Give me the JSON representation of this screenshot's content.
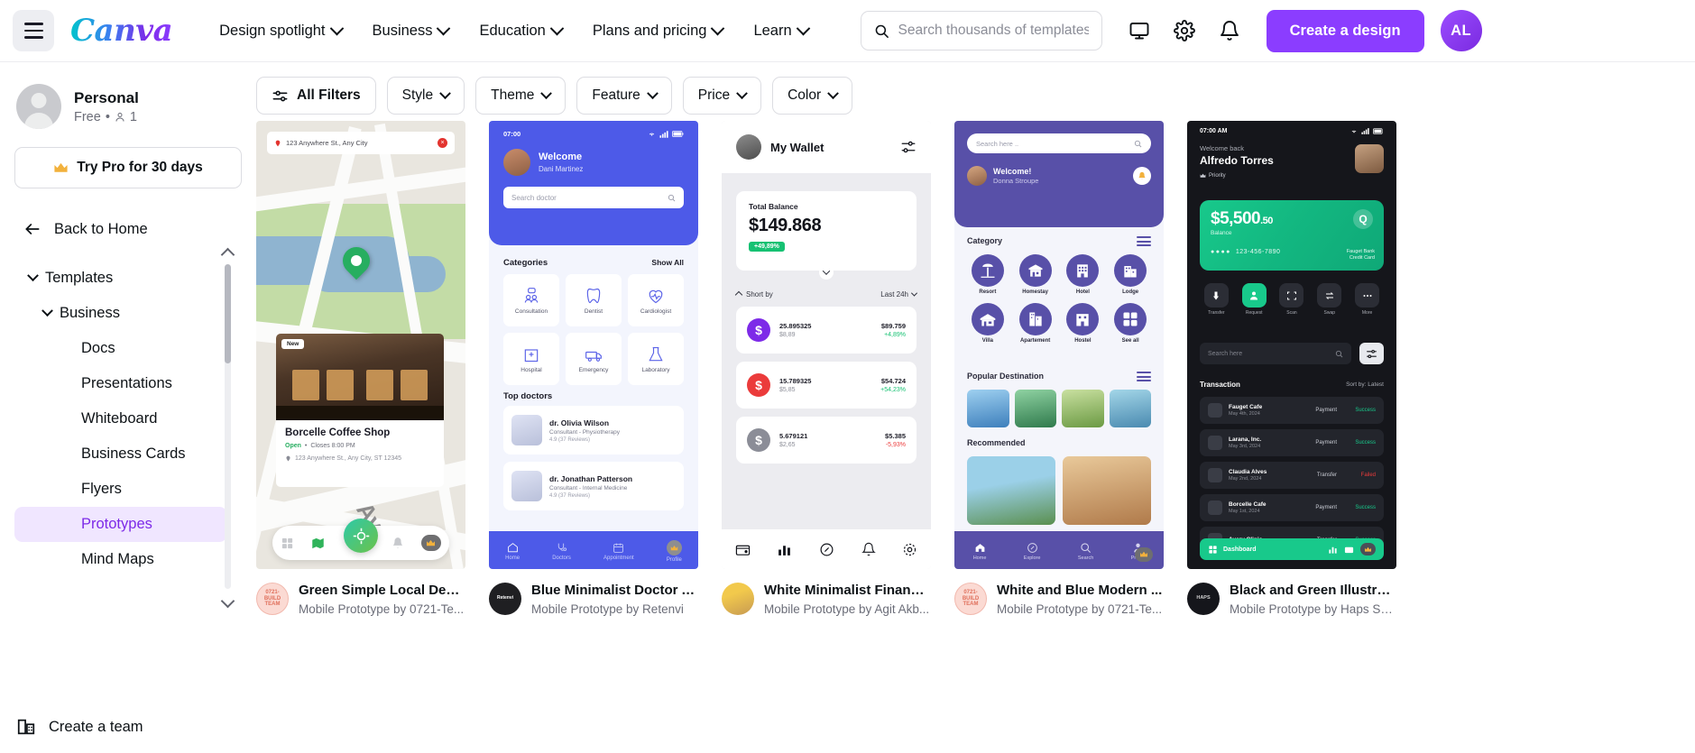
{
  "header": {
    "menu_icon": "hamburger-icon",
    "logo_text": "Canva",
    "nav": [
      {
        "label": "Design spotlight",
        "caret": true
      },
      {
        "label": "Business",
        "caret": true
      },
      {
        "label": "Education",
        "caret": true
      },
      {
        "label": "Plans and pricing",
        "caret": true
      },
      {
        "label": "Learn",
        "caret": true
      }
    ],
    "search": {
      "placeholder": "Search thousands of templates",
      "value": "",
      "icon": "search-icon"
    },
    "icons": [
      "monitor-icon",
      "gear-icon",
      "bell-icon"
    ],
    "create_button": "Create a design",
    "avatar_initials": "AL"
  },
  "sidebar": {
    "profile": {
      "name": "Personal",
      "plan": "Free",
      "separator": "•",
      "members": "1"
    },
    "pro_button": {
      "label": "Try Pro for 30 days",
      "icon": "crown-icon"
    },
    "back_home": {
      "label": "Back to Home",
      "icon": "arrow-left-icon"
    },
    "tree": [
      {
        "label": "Templates",
        "level": 1,
        "caret": true,
        "selected": false
      },
      {
        "label": "Business",
        "level": 2,
        "caret": true,
        "selected": false
      },
      {
        "label": "Docs",
        "level": 3,
        "caret": false,
        "selected": false
      },
      {
        "label": "Presentations",
        "level": 3,
        "caret": false,
        "selected": false
      },
      {
        "label": "Whiteboard",
        "level": 3,
        "caret": false,
        "selected": false
      },
      {
        "label": "Business Cards",
        "level": 3,
        "caret": false,
        "selected": false
      },
      {
        "label": "Flyers",
        "level": 3,
        "caret": false,
        "selected": false
      },
      {
        "label": "Prototypes",
        "level": 3,
        "caret": false,
        "selected": true
      },
      {
        "label": "Mind Maps",
        "level": 3,
        "caret": false,
        "selected": false
      }
    ],
    "create_team": {
      "label": "Create a team",
      "icon": "building-icon"
    }
  },
  "filters": [
    {
      "label": "All Filters",
      "icon": "sliders-icon",
      "caret": false,
      "strong": true
    },
    {
      "label": "Style",
      "caret": true
    },
    {
      "label": "Theme",
      "caret": true
    },
    {
      "label": "Feature",
      "caret": true
    },
    {
      "label": "Price",
      "caret": true
    },
    {
      "label": "Color",
      "caret": true
    }
  ],
  "cards": [
    {
      "title": "Green Simple Local Desti...",
      "subtitle": "Mobile Prototype by 0721-Te...",
      "avatar_text": "0721- BUILD TEAM",
      "avatar_bg": "#fbdad3",
      "avatar_color": "#e0705c"
    },
    {
      "title": "Blue Minimalist Doctor A...",
      "subtitle": "Mobile Prototype by Retenvi",
      "avatar_text": "Retenvi",
      "avatar_bg": "#1f1f22",
      "avatar_color": "#ffffff"
    },
    {
      "title": "White Minimalist Financi...",
      "subtitle": "Mobile Prototype by Agit Akb...",
      "avatar_text": "",
      "avatar_bg": "#f2c94c",
      "avatar_color": "#ffffff"
    },
    {
      "title": "White and Blue Modern ...",
      "subtitle": "Mobile Prototype by 0721-Te...",
      "avatar_text": "0721- BUILD TEAM",
      "avatar_bg": "#fbdad3",
      "avatar_color": "#e0705c"
    },
    {
      "title": "Black and Green Illustrat...",
      "subtitle": "Mobile Prototype by Haps Sp...",
      "avatar_text": "HAPS",
      "avatar_bg": "#15161b",
      "avatar_color": "#cfcfcf"
    }
  ],
  "thumb1": {
    "chip_address": "123 Anywhere St., Any City",
    "badge_new": "New",
    "shop_name": "Borcelle Coffee Shop",
    "open_label": "Open",
    "closes_label": "Closes 8:00 PM",
    "address": "123 Anywhere St., Any City, ST 12345",
    "street_label": "Av"
  },
  "thumb2": {
    "time": "07:00",
    "welcome": "Welcome",
    "user": "Dani Martinez",
    "search_placeholder": "Search doctor",
    "categories_title": "Categories",
    "show_all": "Show All",
    "categories": [
      "Consultation",
      "Dentist",
      "Cardiologist",
      "Hospital",
      "Emergency",
      "Laboratory"
    ],
    "top_doctors_title": "Top doctors",
    "doctors": [
      {
        "name": "dr. Olivia Wilson",
        "spec": "Consultant - Physiotherapy",
        "rating": "4.9 (37 Reviews)"
      },
      {
        "name": "dr. Jonathan Patterson",
        "spec": "Consultant - Internal Medicine",
        "rating": "4.9 (37 Reviews)"
      }
    ],
    "nav": [
      "Home",
      "Doctors",
      "Appointment",
      "Profile"
    ]
  },
  "thumb3": {
    "title": "My Wallet",
    "total_label": "Total Balance",
    "total_amount": "$149.868",
    "change_badge": "+49,89%",
    "sort_label": "Short by",
    "period": "Last 24h",
    "rows": [
      {
        "qty": "25.895325",
        "sub": "$8,89",
        "value": "$89.759",
        "change": "+4,89%",
        "color": "#7d2ae8",
        "positive": true
      },
      {
        "qty": "15.789325",
        "sub": "$5,85",
        "value": "$54.724",
        "change": "+54,23%",
        "color": "#eb3b3b",
        "positive": true
      },
      {
        "qty": "5.679121",
        "sub": "$2,65",
        "value": "$5.385",
        "change": "-5,93%",
        "color": "#8b8d97",
        "positive": false
      }
    ]
  },
  "thumb4": {
    "search_placeholder": "Search here ..",
    "welcome": "Welcome!",
    "user": "Donna Stroupe",
    "category_title": "Category",
    "categories": [
      "Resort",
      "Homestay",
      "Hotel",
      "Lodge",
      "Villa",
      "Apartement",
      "Hostel",
      "See all"
    ],
    "popular_title": "Popular Destination",
    "recommended_title": "Recommended",
    "nav": [
      "Home",
      "Explore",
      "Search",
      "Profile"
    ]
  },
  "thumb5": {
    "time": "07:00 AM",
    "welcome_back": "Welcome back",
    "user": "Alfredo Torres",
    "priority": "Priority",
    "amount": "$5,500",
    "amount_cents": ".50",
    "balance_label": "Balance",
    "card_number": "123-456-7890",
    "bank_name": "Fauget Bank",
    "card_type": "Credit Card",
    "actions": [
      "Transfer",
      "Request",
      "Scan",
      "Swap",
      "More"
    ],
    "search_placeholder": "Search here",
    "transactions_title": "Transaction",
    "sort_label": "Sort by: Latest",
    "rows": [
      {
        "name": "Fauget Cafe",
        "date": "May 4th, 2024",
        "type": "Payment",
        "status": "Success",
        "ok": true
      },
      {
        "name": "Larana, Inc.",
        "date": "May 3rd, 2024",
        "type": "Payment",
        "status": "Success",
        "ok": true
      },
      {
        "name": "Claudia Alves",
        "date": "May 2nd, 2024",
        "type": "Transfer",
        "status": "Failed",
        "ok": false
      },
      {
        "name": "Borcelle Cafe",
        "date": "May 1st, 2024",
        "type": "Payment",
        "status": "Success",
        "ok": true
      },
      {
        "name": "Avery Clinic",
        "date": "",
        "type": "Transfer",
        "status": "Success",
        "ok": true
      }
    ],
    "dashboard_label": "Dashboard"
  },
  "colors": {
    "brand_purple": "#8b3dff",
    "selected_bg": "#f0e6ff",
    "selected_text": "#7d2ae8",
    "doctor_blue": "#4d5ae8",
    "travel_purple": "#5850a8",
    "fintech_green": "#18c98b"
  }
}
